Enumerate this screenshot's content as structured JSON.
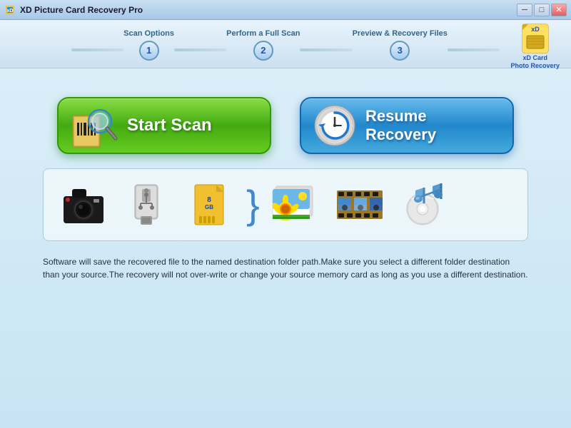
{
  "titlebar": {
    "title": "XD Picture Card Recovery Pro",
    "minimize_label": "─",
    "maximize_label": "□",
    "close_label": "✕"
  },
  "wizard": {
    "step1_label": "Scan Options",
    "step1_num": "1",
    "step2_label": "Perform a Full Scan",
    "step2_num": "2",
    "step3_label": "Preview & Recovery Files",
    "step3_num": "3",
    "logo_text": "xD Card\nPhoto Recovery"
  },
  "buttons": {
    "start_scan": "Start Scan",
    "resume_recovery": "Resume Recovery"
  },
  "description": "Software will save the recovered file to the named destination folder path.Make sure you select a different folder destination than your source.The recovery will not over-write or change your source memory card as long as you use a different destination."
}
